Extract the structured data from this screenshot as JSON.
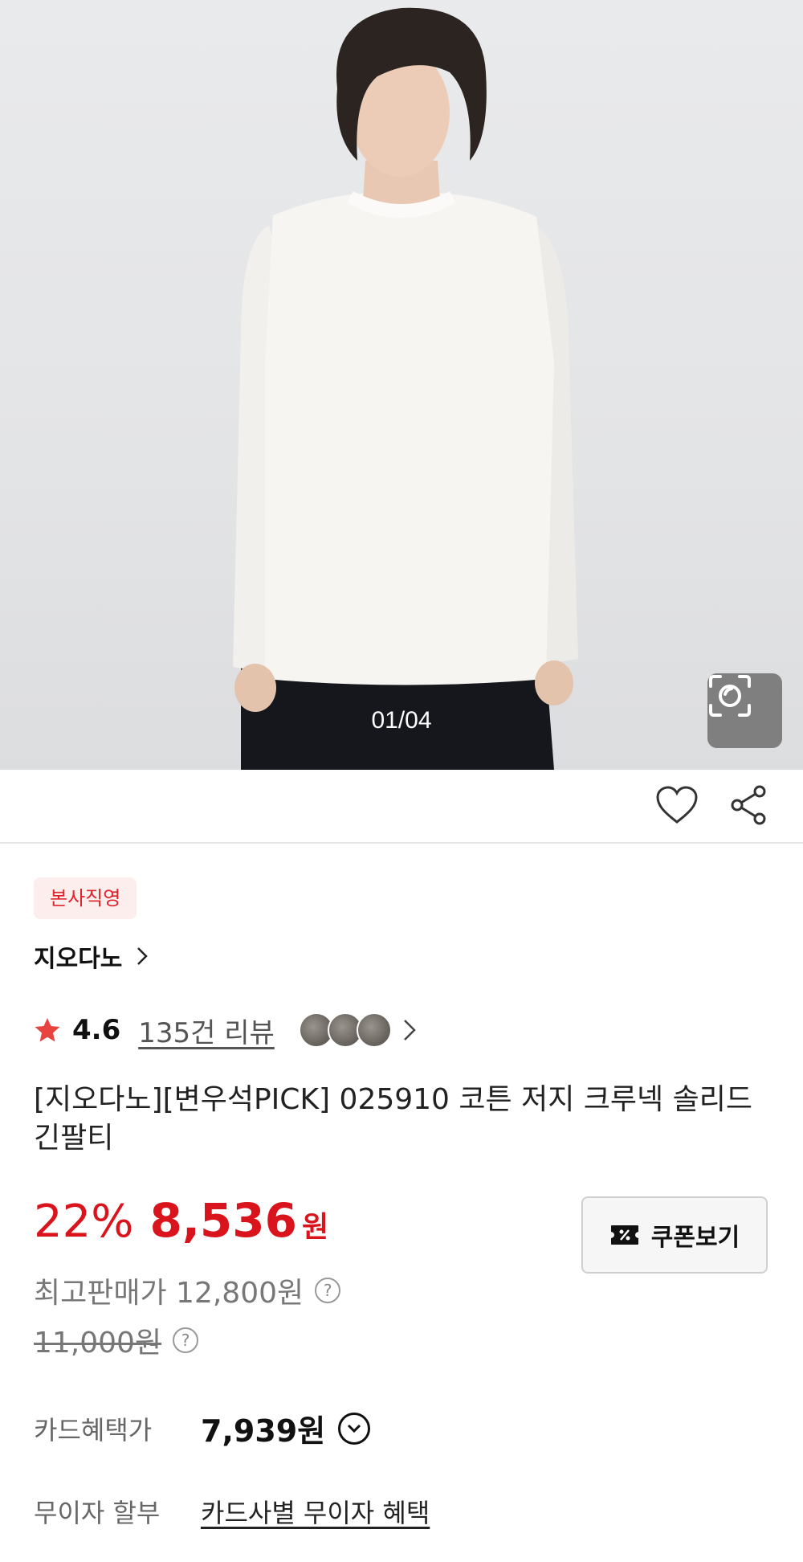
{
  "hero": {
    "image_alt": "model wearing white long sleeve t-shirt",
    "counter": "01/04",
    "lens_icon": "image-search-icon"
  },
  "actions": {
    "wishlist_icon": "heart-icon",
    "share_icon": "share-icon"
  },
  "product": {
    "badge": "본사직영",
    "brand": "지오다노",
    "rating": "4.6",
    "review_link": "135건 리뷰",
    "title": "[지오다노][변우석PICK] 025910 코튼 저지 크루넥 솔리드 긴팔티"
  },
  "pricing": {
    "discount": "22%",
    "price": "8,536",
    "currency": "원",
    "coupon_button": "쿠폰보기",
    "highest_price": "최고판매가 12,800원",
    "list_price": "11,000원",
    "card_benefit_label": "카드혜택가",
    "card_benefit_price": "7,939원",
    "installment_label": "무이자 할부",
    "installment_link": "카드사별 무이자 혜택"
  },
  "colors": {
    "accent": "#d9141c",
    "badge_bg": "#fdeeee",
    "star": "#e8433f"
  }
}
